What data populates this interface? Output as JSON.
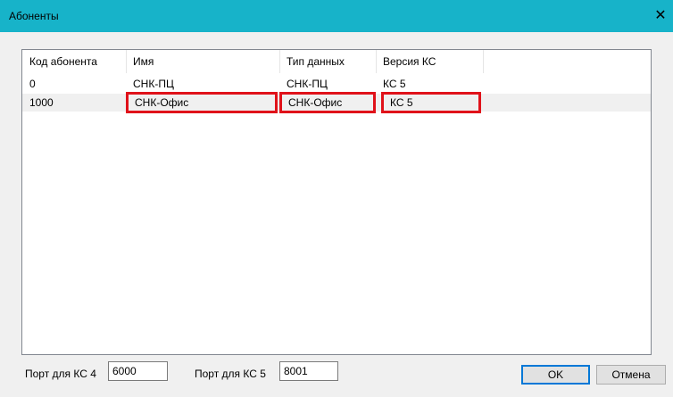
{
  "window": {
    "title": "Абоненты",
    "close_glyph": "✕"
  },
  "table": {
    "columns": [
      "Код абонента",
      "Имя",
      "Тип данных",
      "Версия КС"
    ],
    "rows": [
      [
        "0",
        "СНК-ПЦ",
        "СНК-ПЦ",
        "КС 5"
      ],
      [
        "1000",
        "СНК-Офис",
        "СНК-Офис",
        "КС 5"
      ]
    ]
  },
  "footer": {
    "port_ks4_label": "Порт для КС 4",
    "port_ks4_value": "6000",
    "port_ks5_label": "Порт для КС 5",
    "port_ks5_value": "8001",
    "ok_label": "OK",
    "cancel_label": "Отмена"
  },
  "colors": {
    "titlebar": "#17b3c9",
    "highlight": "#e0121a"
  }
}
